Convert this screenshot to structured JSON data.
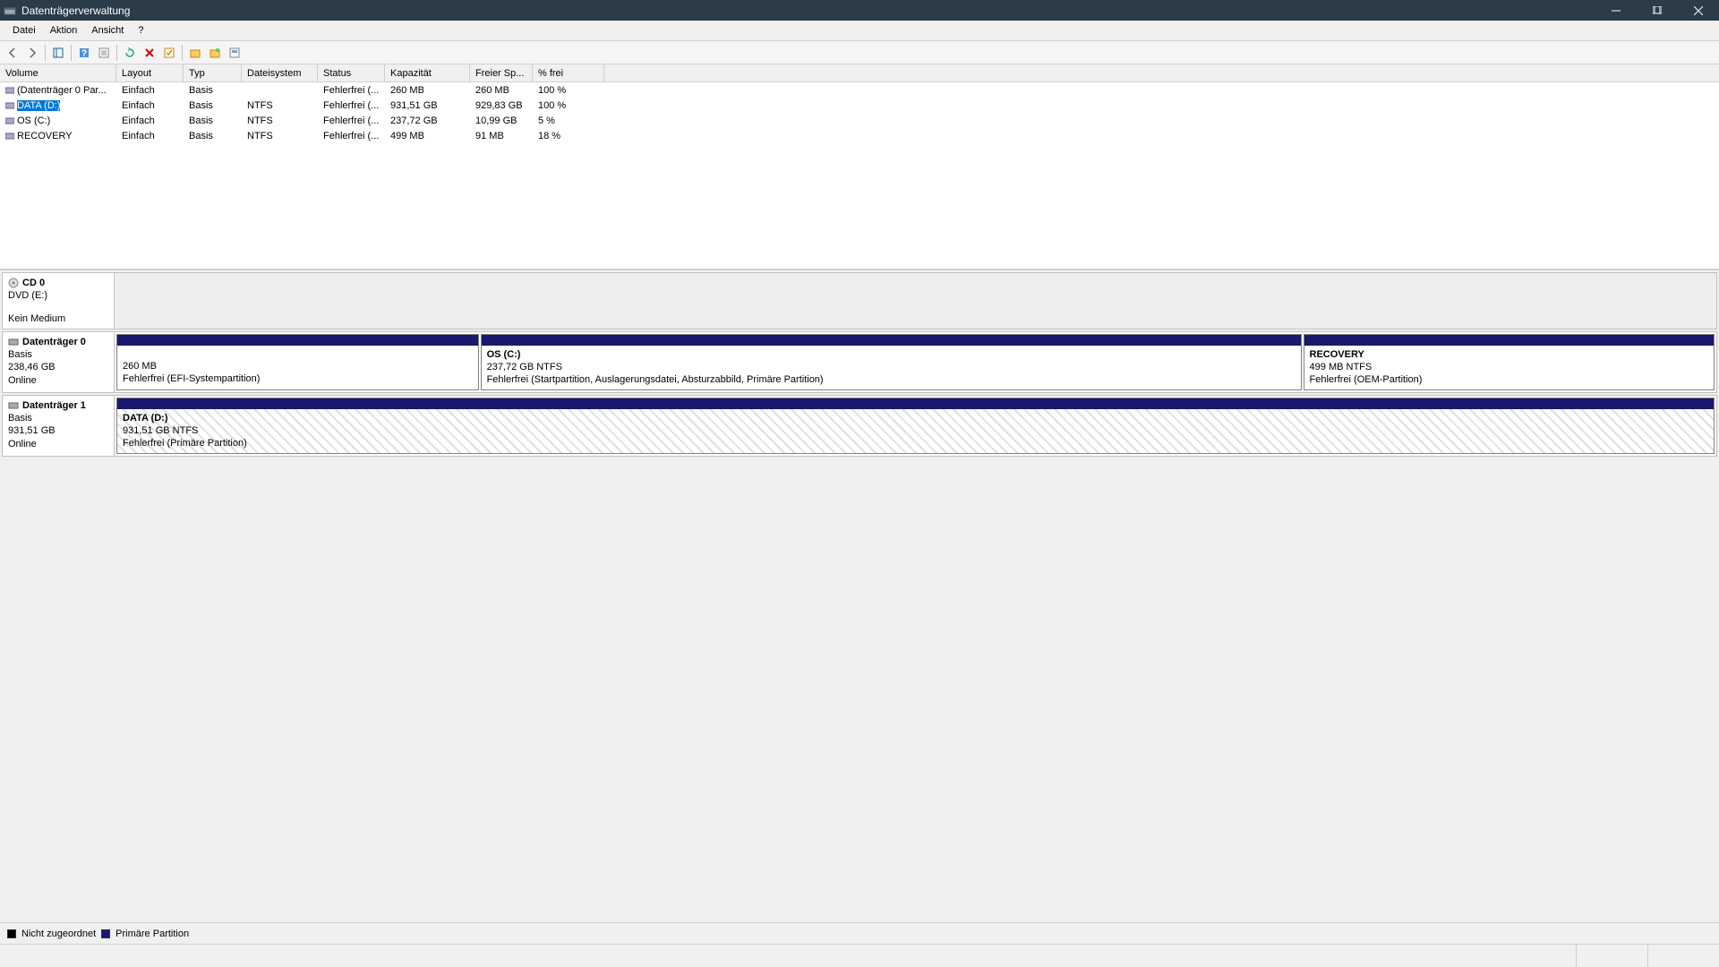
{
  "window": {
    "title": "Datenträgerverwaltung"
  },
  "menu": {
    "datei": "Datei",
    "aktion": "Aktion",
    "ansicht": "Ansicht",
    "help": "?"
  },
  "columns": {
    "volume": "Volume",
    "layout": "Layout",
    "typ": "Typ",
    "dateisystem": "Dateisystem",
    "status": "Status",
    "kapazitat": "Kapazität",
    "freier": "Freier Sp...",
    "pctfrei": "% frei"
  },
  "volumes": [
    {
      "name": "(Datenträger 0 Par...",
      "layout": "Einfach",
      "typ": "Basis",
      "fs": "",
      "status": "Fehlerfrei (...",
      "cap": "260 MB",
      "free": "260 MB",
      "pct": "100 %",
      "selected": false
    },
    {
      "name": "DATA (D:)",
      "layout": "Einfach",
      "typ": "Basis",
      "fs": "NTFS",
      "status": "Fehlerfrei (...",
      "cap": "931,51 GB",
      "free": "929,83 GB",
      "pct": "100 %",
      "selected": true
    },
    {
      "name": "OS (C:)",
      "layout": "Einfach",
      "typ": "Basis",
      "fs": "NTFS",
      "status": "Fehlerfrei (...",
      "cap": "237,72 GB",
      "free": "10,99 GB",
      "pct": "5 %",
      "selected": false
    },
    {
      "name": "RECOVERY",
      "layout": "Einfach",
      "typ": "Basis",
      "fs": "NTFS",
      "status": "Fehlerfrei (...",
      "cap": "499 MB",
      "free": "91 MB",
      "pct": "18 %",
      "selected": false
    }
  ],
  "disks": {
    "cd0": {
      "title": "CD 0",
      "line1": "DVD (E:)",
      "line2": "Kein Medium"
    },
    "d0": {
      "title": "Datenträger 0",
      "type": "Basis",
      "size": "238,46 GB",
      "state": "Online",
      "parts": [
        {
          "name": "",
          "size": "260 MB",
          "status": "Fehlerfrei (EFI-Systempartition)",
          "flex": 22
        },
        {
          "name": "OS  (C:)",
          "size": "237,72 GB NTFS",
          "status": "Fehlerfrei (Startpartition, Auslagerungsdatei, Absturzabbild, Primäre Partition)",
          "flex": 50
        },
        {
          "name": "RECOVERY",
          "size": "499 MB NTFS",
          "status": "Fehlerfrei (OEM-Partition)",
          "flex": 25
        }
      ]
    },
    "d1": {
      "title": "Datenträger 1",
      "type": "Basis",
      "size": "931,51 GB",
      "state": "Online",
      "parts": [
        {
          "name": "DATA  (D:)",
          "size": "931,51 GB NTFS",
          "status": "Fehlerfrei (Primäre Partition)",
          "flex": 100,
          "hatched": true
        }
      ]
    }
  },
  "legend": {
    "unalloc": "Nicht zugeordnet",
    "primary": "Primäre Partition"
  }
}
